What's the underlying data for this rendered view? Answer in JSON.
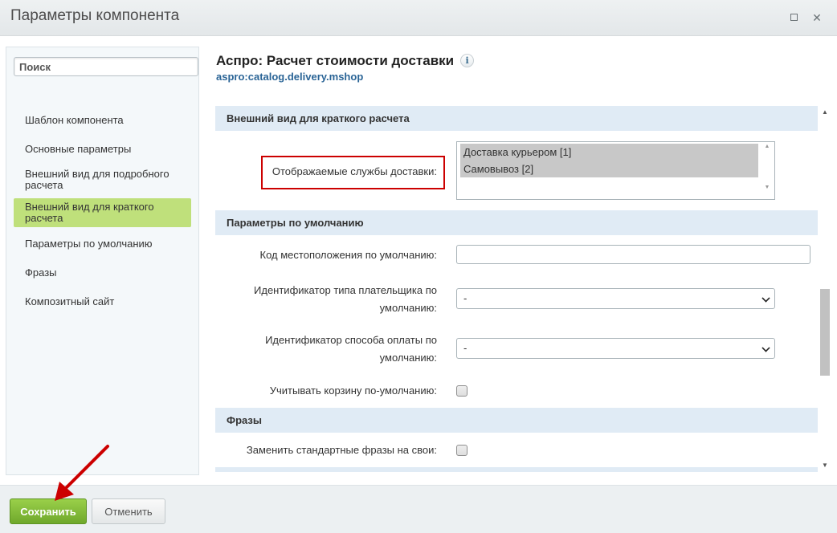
{
  "window": {
    "title": "Параметры компонента",
    "maximize_icon": "maximize-icon",
    "close_icon": "close-icon",
    "close_glyph": "✕"
  },
  "sidebar": {
    "search_placeholder": "Поиск",
    "items": [
      {
        "label": "Шаблон компонента",
        "active": false
      },
      {
        "label": "Основные параметры",
        "active": false
      },
      {
        "label": "Внешний вид для подробного расчета",
        "active": false
      },
      {
        "label": "Внешний вид для краткого расчета",
        "active": true
      },
      {
        "label": "Параметры по умолчанию",
        "active": false
      },
      {
        "label": "Фразы",
        "active": false
      },
      {
        "label": "Композитный сайт",
        "active": false
      }
    ]
  },
  "component": {
    "title": "Аспро: Расчет стоимости доставки",
    "info_glyph": "i",
    "code": "aspro:catalog.delivery.mshop"
  },
  "sections": {
    "short_view": {
      "title": "Внешний вид для краткого расчета",
      "delivery_label": "Отображаемые службы доставки:",
      "delivery_options": [
        "Доставка курьером [1]",
        "Самовывоз [2]"
      ]
    },
    "defaults": {
      "title": "Параметры по умолчанию",
      "location_label": "Код местоположения по умолчанию:",
      "location_value": "",
      "payer_label_1": "Идентификатор типа плательщика по",
      "payer_label_2": "умолчанию:",
      "payer_value": "-",
      "paysystem_label_1": "Идентификатор способа оплаты по",
      "paysystem_label_2": "умолчанию:",
      "paysystem_value": "-",
      "basket_label": "Учитывать корзину по-умолчанию:"
    },
    "phrases": {
      "title": "Фразы",
      "replace_label": "Заменить стандартные фразы на свои:"
    }
  },
  "footer": {
    "save_label": "Сохранить",
    "cancel_label": "Отменить"
  },
  "colors": {
    "accent_green": "#8cc63f",
    "active_nav": "#bfe07b",
    "section_header": "#e0ebf5",
    "annotation_red": "#cc0000"
  }
}
